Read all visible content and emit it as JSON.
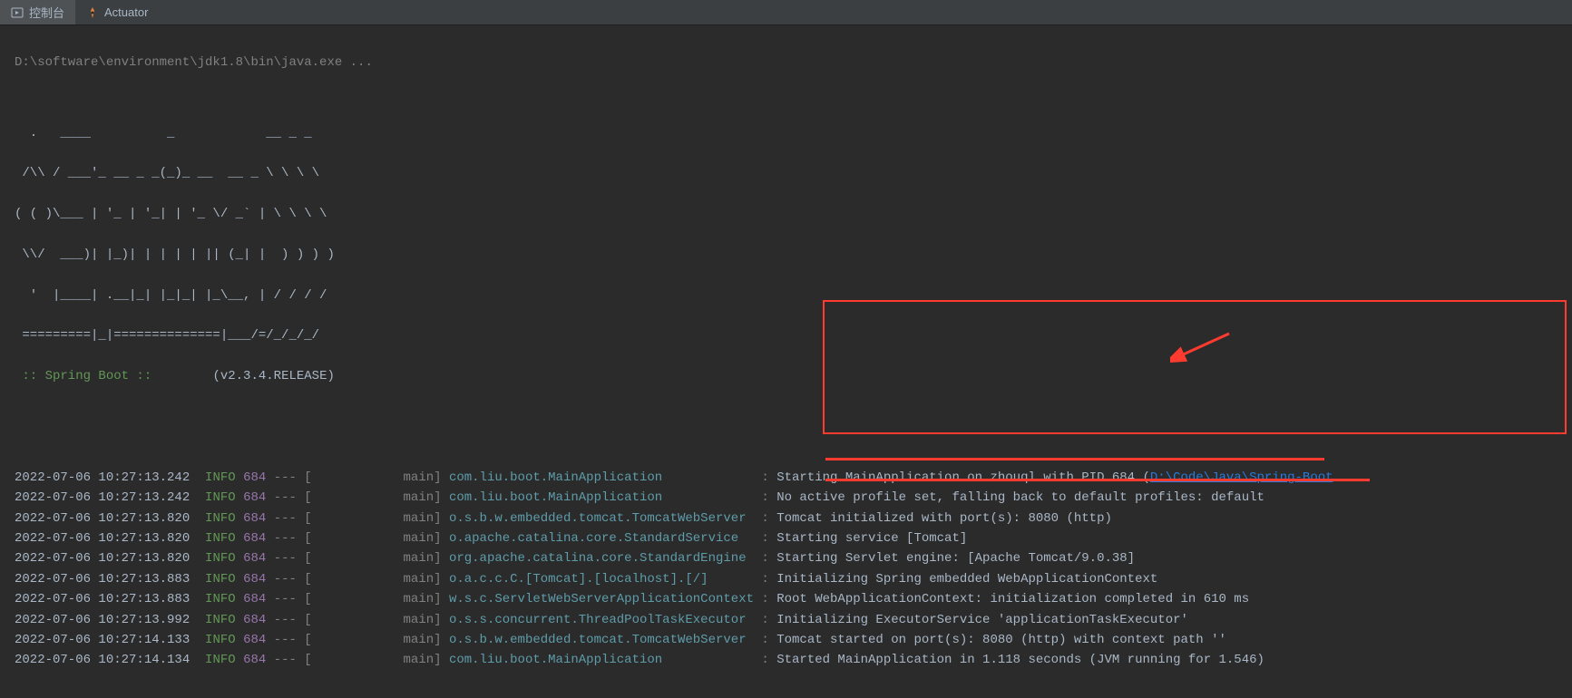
{
  "tabs": {
    "console": "控制台",
    "actuator": "Actuator"
  },
  "cmd": "D:\\software\\environment\\jdk1.8\\bin\\java.exe ...",
  "banner": [
    "  .   ____          _            __ _ _",
    " /\\\\ / ___'_ __ _ _(_)_ __  __ _ \\ \\ \\ \\",
    "( ( )\\___ | '_ | '_| | '_ \\/ _` | \\ \\ \\ \\",
    " \\\\/  ___)| |_)| | | | | || (_| |  ) ) ) )",
    "  '  |____| .__|_| |_|_| |_\\__, | / / / /",
    " =========|_|==============|___/=/_/_/_/"
  ],
  "springLabel": " :: Spring Boot :: ",
  "springVersion": "       (v2.3.4.RELEASE)",
  "logs": [
    {
      "ts": "2022-07-06 10:27:13.242",
      "level": "INFO",
      "pid": "684",
      "thread": "main",
      "logger": "com.liu.boot.MainApplication            ",
      "msgPrefix": "Starting MainApplication on zhouql with PID 684 (",
      "link": "D:\\Code\\Java\\Spring-Boot",
      "msgSuffix": ""
    },
    {
      "ts": "2022-07-06 10:27:13.242",
      "level": "INFO",
      "pid": "684",
      "thread": "main",
      "logger": "com.liu.boot.MainApplication            ",
      "msg": "No active profile set, falling back to default profiles: default"
    },
    {
      "ts": "2022-07-06 10:27:13.820",
      "level": "INFO",
      "pid": "684",
      "thread": "main",
      "logger": "o.s.b.w.embedded.tomcat.TomcatWebServer ",
      "msg": "Tomcat initialized with port(s): 8080 (http)"
    },
    {
      "ts": "2022-07-06 10:27:13.820",
      "level": "INFO",
      "pid": "684",
      "thread": "main",
      "logger": "o.apache.catalina.core.StandardService  ",
      "msg": "Starting service [Tomcat]"
    },
    {
      "ts": "2022-07-06 10:27:13.820",
      "level": "INFO",
      "pid": "684",
      "thread": "main",
      "logger": "org.apache.catalina.core.StandardEngine ",
      "msg": "Starting Servlet engine: [Apache Tomcat/9.0.38]"
    },
    {
      "ts": "2022-07-06 10:27:13.883",
      "level": "INFO",
      "pid": "684",
      "thread": "main",
      "logger": "o.a.c.c.C.[Tomcat].[localhost].[/]      ",
      "msg": "Initializing Spring embedded WebApplicationContext"
    },
    {
      "ts": "2022-07-06 10:27:13.883",
      "level": "INFO",
      "pid": "684",
      "thread": "main",
      "logger": "w.s.c.ServletWebServerApplicationContext",
      "msg": "Root WebApplicationContext: initialization completed in 610 ms"
    },
    {
      "ts": "2022-07-06 10:27:13.992",
      "level": "INFO",
      "pid": "684",
      "thread": "main",
      "logger": "o.s.s.concurrent.ThreadPoolTaskExecutor ",
      "msg": "Initializing ExecutorService 'applicationTaskExecutor'"
    },
    {
      "ts": "2022-07-06 10:27:14.133",
      "level": "INFO",
      "pid": "684",
      "thread": "main",
      "logger": "o.s.b.w.embedded.tomcat.TomcatWebServer ",
      "msg": "Tomcat started on port(s): 8080 (http) with context path ''"
    },
    {
      "ts": "2022-07-06 10:27:14.134",
      "level": "INFO",
      "pid": "684",
      "thread": "main",
      "logger": "com.liu.boot.MainApplication            ",
      "msg": "Started MainApplication in 1.118 seconds (JVM running for 1.546)"
    }
  ]
}
